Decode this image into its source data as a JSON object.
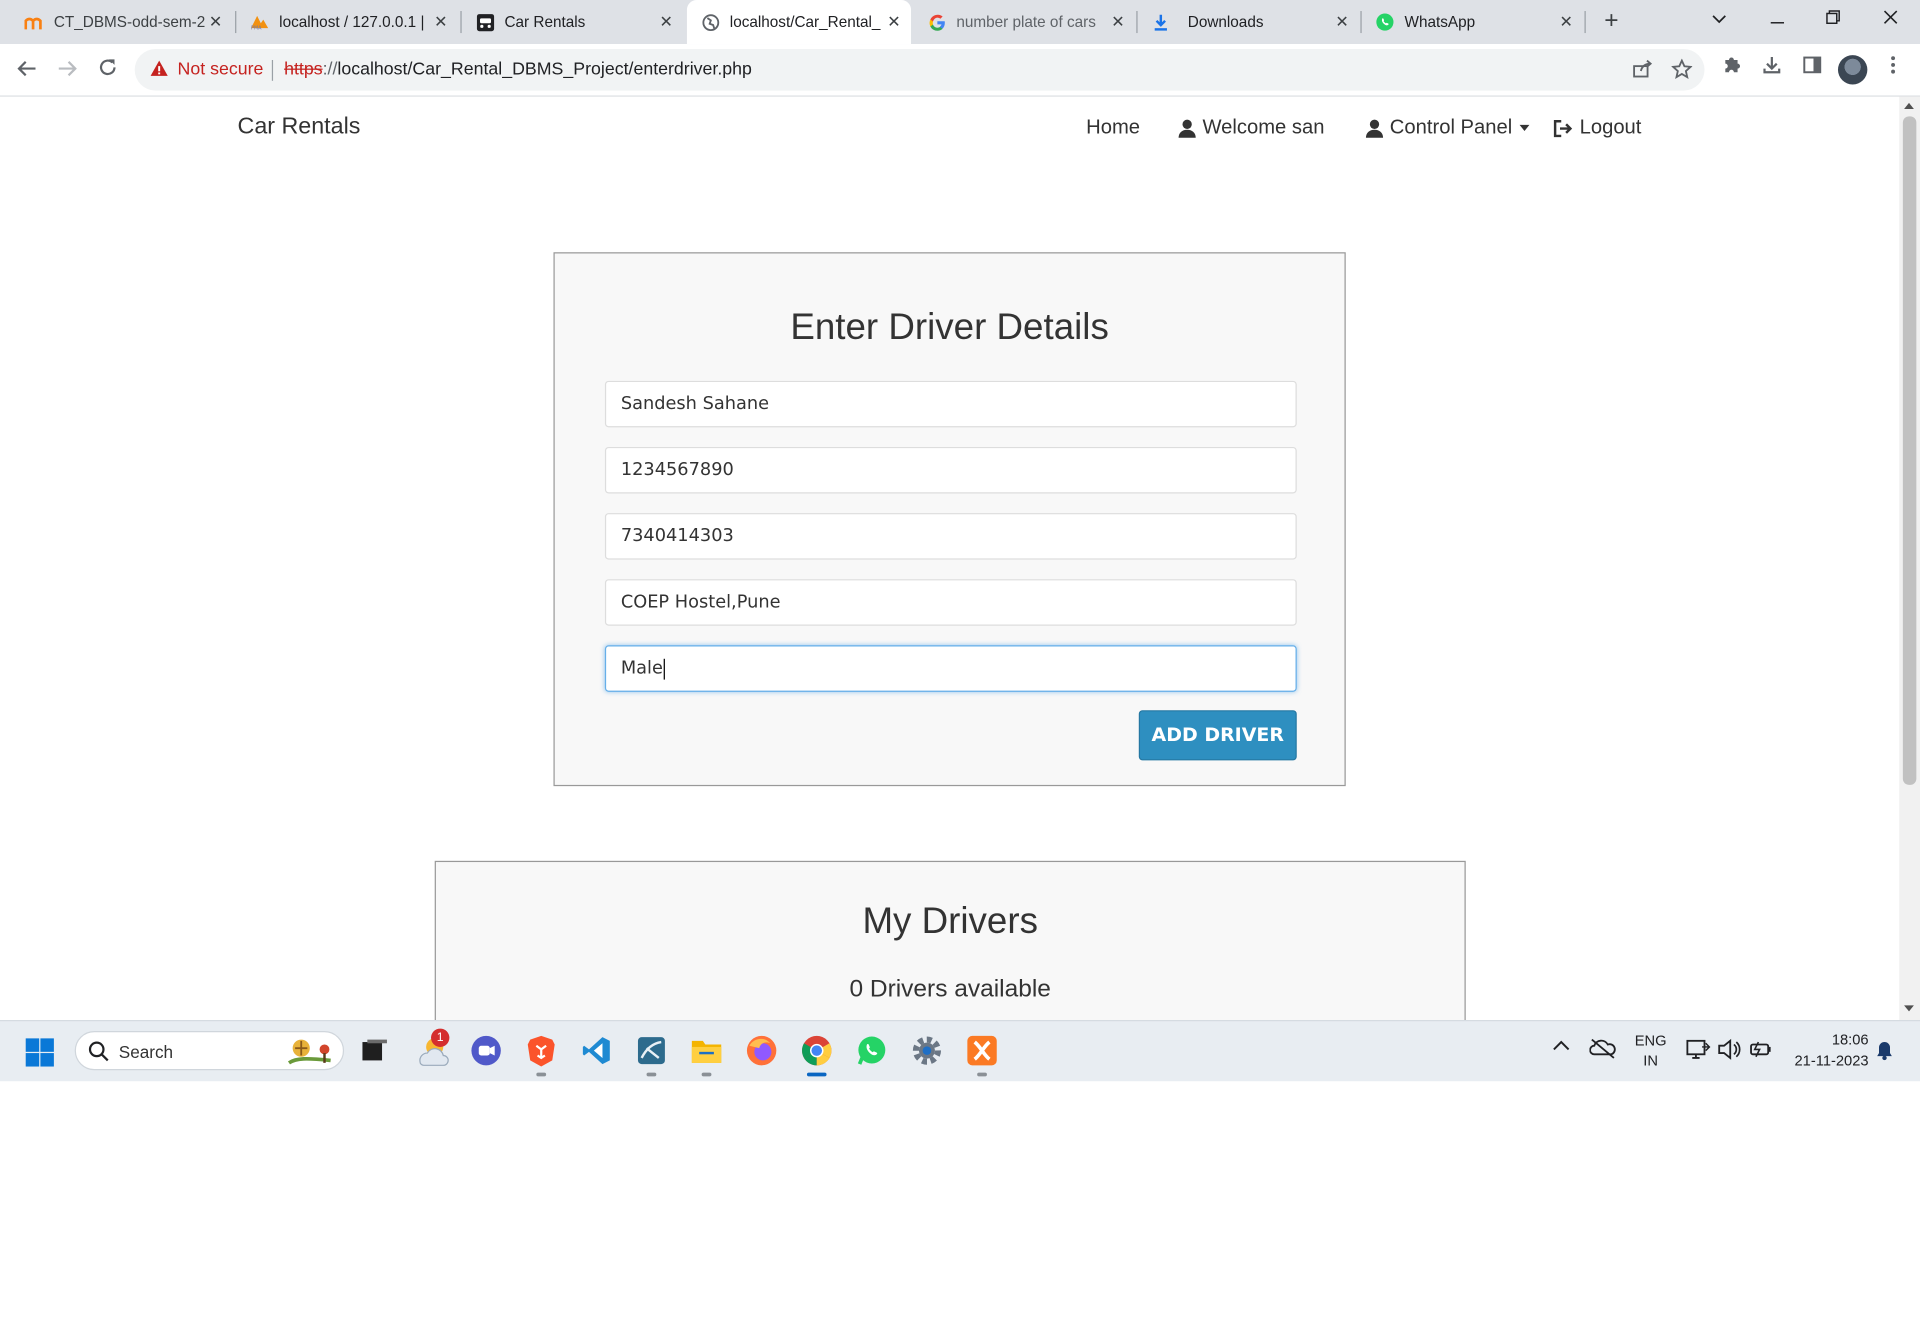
{
  "tabs": [
    {
      "title": "CT_DBMS-odd-sem-2",
      "icon": "moodle-icon",
      "active": false
    },
    {
      "title": "localhost / 127.0.0.1 |",
      "icon": "phpmyadmin-icon",
      "active": false
    },
    {
      "title": "Car Rentals",
      "icon": "car-rentals-icon",
      "active": false
    },
    {
      "title": "localhost/Car_Rental_",
      "icon": "globe-icon",
      "active": true
    },
    {
      "title": "number plate of cars",
      "icon": "google-icon",
      "active": false
    },
    {
      "title": "Downloads",
      "icon": "download-icon",
      "active": false
    },
    {
      "title": "WhatsApp",
      "icon": "whatsapp-icon",
      "active": false
    }
  ],
  "omnibox": {
    "security_label": "Not secure",
    "url_protocol": "https",
    "url_sep": "://",
    "url_rest": "localhost/Car_Rental_DBMS_Project/enterdriver.php"
  },
  "navbar": {
    "brand": "Car Rentals",
    "home": "Home",
    "welcome": "Welcome san",
    "control_panel": "Control Panel",
    "logout": "Logout"
  },
  "form": {
    "title": "Enter Driver Details",
    "fields": [
      {
        "name": "driver-name",
        "value": "Sandesh Sahane"
      },
      {
        "name": "license-number",
        "value": "1234567890"
      },
      {
        "name": "phone-number",
        "value": "7340414303"
      },
      {
        "name": "address",
        "value": "COEP Hostel,Pune"
      },
      {
        "name": "gender",
        "value": "Male"
      }
    ],
    "submit_label": "ADD DRIVER"
  },
  "drivers_panel": {
    "title": "My Drivers",
    "subtitle": "0 Drivers available"
  },
  "taskbar": {
    "search_label": "Search",
    "notification_badge": "1",
    "lang_line1": "ENG",
    "lang_line2": "IN",
    "time": "18:06",
    "date": "21-11-2023"
  }
}
